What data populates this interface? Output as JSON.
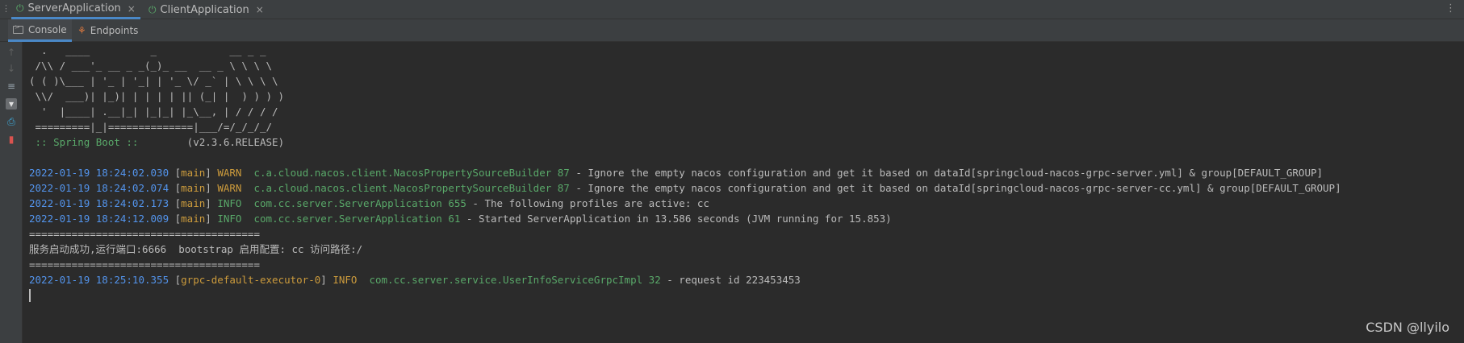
{
  "run_tabs": [
    {
      "label": "ServerApplication",
      "active": true
    },
    {
      "label": "ClientApplication",
      "active": false
    }
  ],
  "close_glyph": "×",
  "sub_tabs": [
    {
      "label": "Console"
    },
    {
      "label": "Endpoints"
    }
  ],
  "banner": [
    "  .   ____          _            __ _ _",
    " /\\\\ / ___'_ __ _ _(_)_ __  __ _ \\ \\ \\ \\",
    "( ( )\\___ | '_ | '_| | '_ \\/ _` | \\ \\ \\ \\",
    " \\\\/  ___)| |_)| | | | | || (_| |  ) ) ) )",
    "  '  |____| .__|_| |_|_| |_\\__, | / / / /",
    " =========|_|==============|___/=/_/_/_/"
  ],
  "spring_boot": {
    "label": " :: Spring Boot :: ",
    "version": "       (v2.3.6.RELEASE)"
  },
  "logs": [
    {
      "ts": "2022-01-19 18:24:02.030",
      "thread": "main",
      "level": "WARN ",
      "logger": "c.a.cloud.nacos.client.NacosPropertySourceBuilder 87",
      "message": " - Ignore the empty nacos configuration and get it based on dataId[springcloud-nacos-grpc-server.yml] & group[DEFAULT_GROUP]"
    },
    {
      "ts": "2022-01-19 18:24:02.074",
      "thread": "main",
      "level": "WARN ",
      "logger": "c.a.cloud.nacos.client.NacosPropertySourceBuilder 87",
      "message": " - Ignore the empty nacos configuration and get it based on dataId[springcloud-nacos-grpc-server-cc.yml] & group[DEFAULT_GROUP]"
    },
    {
      "ts": "2022-01-19 18:24:02.173",
      "thread": "main",
      "level": "INFO ",
      "logger": "com.cc.server.ServerApplication 655",
      "message": " - The following profiles are active: cc"
    },
    {
      "ts": "2022-01-19 18:24:12.009",
      "thread": "main",
      "level": "INFO ",
      "logger": "com.cc.server.ServerApplication 61",
      "message": " - Started ServerApplication in 13.586 seconds (JVM running for 15.853)"
    }
  ],
  "separator": "======================================",
  "startup_message": "服务启动成功,运行端口:6666  bootstrap 启用配置: cc 访问路径:/",
  "last_log": {
    "ts": "2022-01-19 18:25:10.355",
    "thread": "grpc-default-executor-0",
    "level": "INFO ",
    "logger": "com.cc.server.service.UserInfoServiceGrpcImpl 32",
    "message": " - request id 223453453"
  },
  "watermark": "CSDN @llyilo",
  "gutter_icons": [
    "arrow-up-icon",
    "arrow-down-icon",
    "soft-wrap-icon",
    "scroll-to-end-icon",
    "print-icon",
    "trash-icon"
  ]
}
